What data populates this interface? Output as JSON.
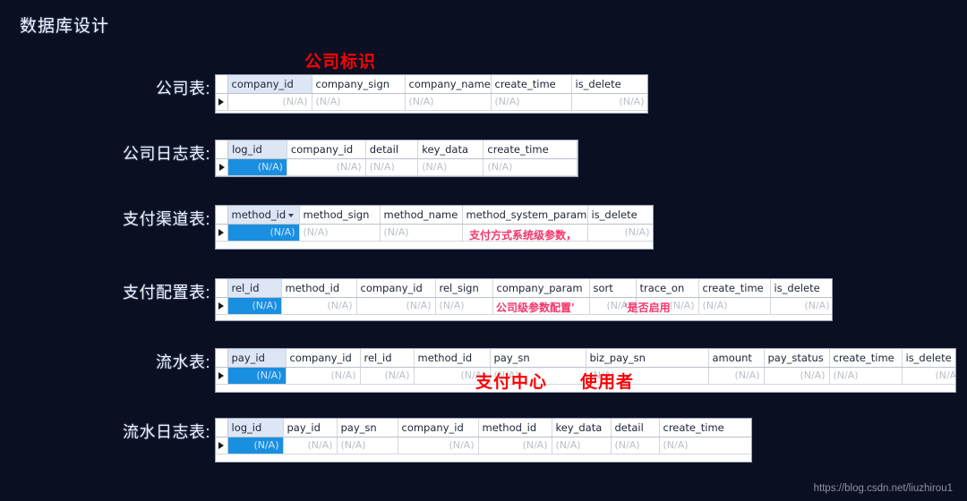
{
  "slide": {
    "title": "数据库设计",
    "watermark": "https://blog.csdn.net/liuzhirou1",
    "na_text": "(N/A)",
    "background_color": "#0a1021",
    "annotation_color": "#fb0006",
    "selected_cell_color": "#1a8fe0",
    "header_first_col_color": "#dce6f4"
  },
  "annotations": [
    {
      "id": "company-sign-note",
      "text": "公司标识",
      "size": "big"
    },
    {
      "id": "method-system-param-note",
      "text": "支付方式系统级参数，",
      "size": "small"
    },
    {
      "id": "company-param-note",
      "text": "公司级参数配置'",
      "size": "small"
    },
    {
      "id": "trace-on-note",
      "text": "'是否启用",
      "size": "small"
    },
    {
      "id": "pay-center-note",
      "text": "支付中心",
      "size": "big"
    },
    {
      "id": "user-note",
      "text": "使用者",
      "size": "big"
    }
  ],
  "tables": [
    {
      "id": "company-table",
      "label": "公司表:",
      "columns": [
        "company_id",
        "company_sign",
        "company_name",
        "create_time",
        "is_delete"
      ],
      "values": [
        "(N/A)",
        "(N/A)",
        "(N/A)",
        "(N/A)",
        "(N/A)"
      ],
      "alignments": [
        "right",
        "left",
        "left",
        "left",
        "right"
      ],
      "first_cell_selected": false
    },
    {
      "id": "company-log-table",
      "label": "公司日志表:",
      "columns": [
        "log_id",
        "company_id",
        "detail",
        "key_data",
        "create_time"
      ],
      "values": [
        "(N/A)",
        "(N/A)",
        "(N/A)",
        "(N/A)",
        "(N/A)"
      ],
      "alignments": [
        "right",
        "right",
        "left",
        "left",
        "left"
      ],
      "first_cell_selected": true
    },
    {
      "id": "pay-method-table",
      "label": "支付渠道表:",
      "columns": [
        "method_id",
        "method_sign",
        "method_name",
        "method_system_param",
        "is_delete"
      ],
      "values": [
        "(N/A)",
        "(N/A)",
        "(N/A)",
        "",
        "(N/A)"
      ],
      "alignments": [
        "right",
        "left",
        "left",
        "left",
        "right"
      ],
      "first_cell_selected": true,
      "header_dropdown_col": 0
    },
    {
      "id": "pay-config-table",
      "label": "支付配置表:",
      "columns": [
        "rel_id",
        "method_id",
        "company_id",
        "rel_sign",
        "company_param",
        "sort",
        "trace_on",
        "create_time",
        "is_delete"
      ],
      "values": [
        "(N/A)",
        "(N/A)",
        "(N/A)",
        "(N/A)",
        "",
        "(N/A)",
        "(N/A)",
        "(N/A)",
        "(N/A)"
      ],
      "alignments": [
        "right",
        "right",
        "right",
        "left",
        "left",
        "right",
        "right",
        "left",
        "right"
      ],
      "first_cell_selected": true
    },
    {
      "id": "pay-flow-table",
      "label": "流水表:",
      "columns": [
        "pay_id",
        "company_id",
        "rel_id",
        "method_id",
        "pay_sn",
        "biz_pay_sn",
        "amount",
        "pay_status",
        "create_time",
        "is_delete"
      ],
      "values": [
        "(N/A)",
        "(N/A)",
        "(N/A)",
        "(N/A)",
        "(N/A)",
        "(N/A)",
        "(N/A)",
        "(N/A)",
        "(N/A)",
        "(N/A)"
      ],
      "alignments": [
        "right",
        "right",
        "right",
        "right",
        "left",
        "left",
        "right",
        "right",
        "left",
        "right"
      ],
      "first_cell_selected": true
    },
    {
      "id": "pay-flow-log-table",
      "label": "流水日志表:",
      "columns": [
        "log_id",
        "pay_id",
        "pay_sn",
        "company_id",
        "method_id",
        "key_data",
        "detail",
        "create_time"
      ],
      "values": [
        "(N/A)",
        "(N/A)",
        "(N/A)",
        "(N/A)",
        "(N/A)",
        "(N/A)",
        "(N/A)",
        "(N/A)"
      ],
      "alignments": [
        "right",
        "right",
        "left",
        "right",
        "right",
        "left",
        "left",
        "left"
      ],
      "first_cell_selected": true
    }
  ]
}
